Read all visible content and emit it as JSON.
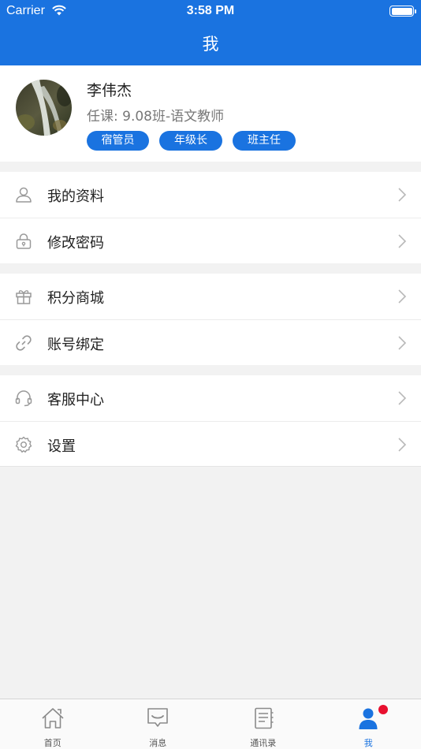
{
  "status_bar": {
    "carrier": "Carrier",
    "time": "3:58 PM"
  },
  "nav": {
    "title": "我"
  },
  "profile": {
    "name": "李伟杰",
    "duty": "任课: 9.08班-语文教师",
    "tags": [
      "宿管员",
      "年级长",
      "班主任"
    ]
  },
  "menu": {
    "group1": [
      {
        "label": "我的资料",
        "icon": "user-icon"
      },
      {
        "label": "修改密码",
        "icon": "lock-icon"
      }
    ],
    "group2": [
      {
        "label": "积分商城",
        "icon": "gift-icon"
      },
      {
        "label": "账号绑定",
        "icon": "link-icon"
      }
    ],
    "group3": [
      {
        "label": "客服中心",
        "icon": "headset-icon"
      },
      {
        "label": "设置",
        "icon": "gear-icon"
      }
    ]
  },
  "tabbar": {
    "items": [
      {
        "label": "首页",
        "icon": "home-icon"
      },
      {
        "label": "消息",
        "icon": "message-icon"
      },
      {
        "label": "通讯录",
        "icon": "contacts-icon"
      },
      {
        "label": "我",
        "icon": "person-icon"
      }
    ],
    "active_index": 3,
    "badge_on": "我"
  },
  "colors": {
    "brand": "#1a73e0",
    "badge": "#e8102f",
    "background": "#f2f2f2"
  }
}
